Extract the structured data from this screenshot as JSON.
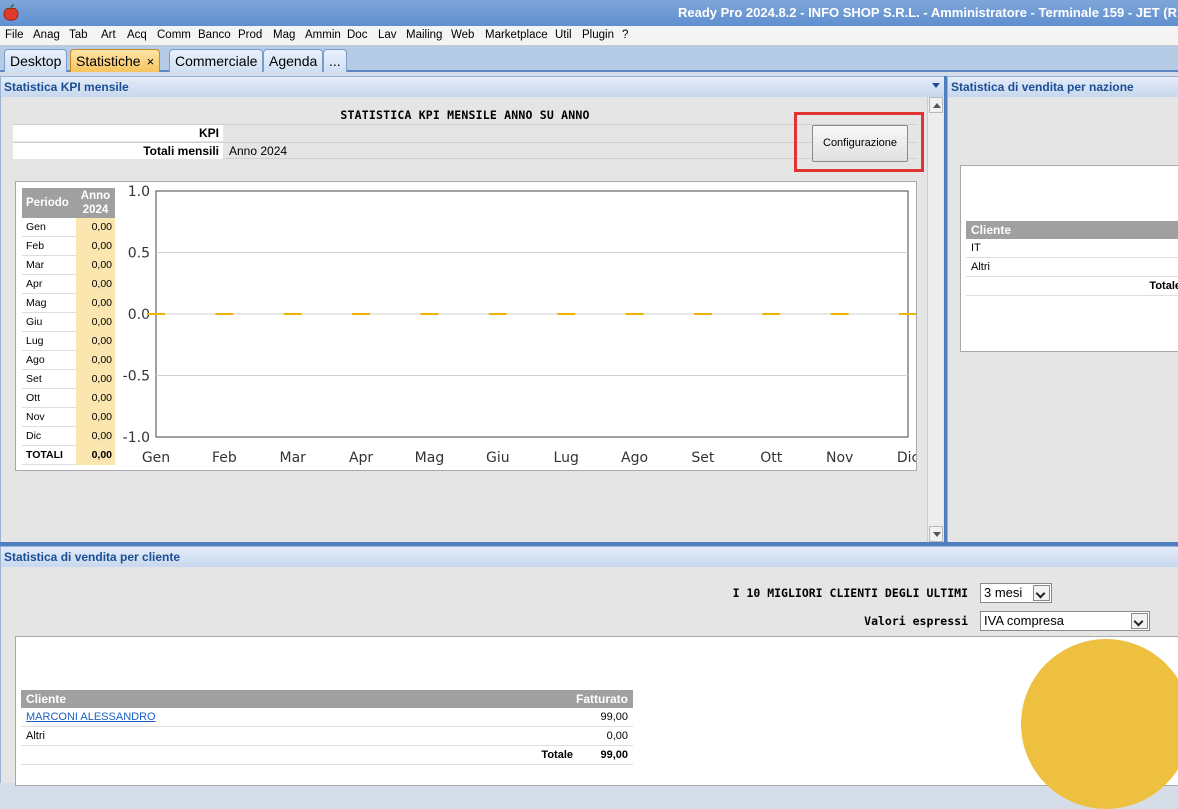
{
  "window": {
    "title": "Ready Pro 2024.8.2 - INFO SHOP S.R.L. - Amministratore - Terminale 159 - JET (R"
  },
  "menu": [
    "File",
    "Anag",
    "Tab",
    "Art",
    "Acq",
    "Comm",
    "Banco",
    "Prod",
    "Mag",
    "Ammin",
    "Doc",
    "Lav",
    "Mailing",
    "Web",
    "Marketplace",
    "Util",
    "Plugin",
    "?"
  ],
  "tabs": [
    {
      "label": "Desktop",
      "active": false
    },
    {
      "label": "Statistiche",
      "active": true,
      "close": "×"
    },
    {
      "label": "Commerciale",
      "active": false
    },
    {
      "label": "Agenda",
      "active": false
    },
    {
      "label": "...",
      "active": false
    }
  ],
  "kpi_panel": {
    "header": "Statistica KPI mensile",
    "title": "STATISTICA KPI MENSILE ANNO SU ANNO",
    "kpi_label": "KPI",
    "kpi_value": "",
    "totals_label": "Totali mensili",
    "totals_value": "Anno 2024",
    "config_button": "Configurazione",
    "table": {
      "col_period": "Periodo",
      "col_year": "Anno 2024",
      "rows": [
        {
          "month": "Gen",
          "value": "0,00"
        },
        {
          "month": "Feb",
          "value": "0,00"
        },
        {
          "month": "Mar",
          "value": "0,00"
        },
        {
          "month": "Apr",
          "value": "0,00"
        },
        {
          "month": "Mag",
          "value": "0,00"
        },
        {
          "month": "Giu",
          "value": "0,00"
        },
        {
          "month": "Lug",
          "value": "0,00"
        },
        {
          "month": "Ago",
          "value": "0,00"
        },
        {
          "month": "Set",
          "value": "0,00"
        },
        {
          "month": "Ott",
          "value": "0,00"
        },
        {
          "month": "Nov",
          "value": "0,00"
        },
        {
          "month": "Dic",
          "value": "0,00"
        }
      ],
      "total_label": "TOTALI",
      "total_value": "0,00"
    }
  },
  "chart_data": {
    "type": "bar",
    "categories": [
      "Gen",
      "Feb",
      "Mar",
      "Apr",
      "Mag",
      "Giu",
      "Lug",
      "Ago",
      "Set",
      "Ott",
      "Nov",
      "Dic"
    ],
    "values": [
      0,
      0,
      0,
      0,
      0,
      0,
      0,
      0,
      0,
      0,
      0,
      0
    ],
    "yticks": [
      "1.0",
      "0.5",
      "0.0",
      "-0.5",
      "-1.0"
    ],
    "ylim": [
      -1,
      1
    ],
    "grid": true,
    "bar_color": "#f0b400"
  },
  "nation_panel": {
    "header": "Statistica di vendita per nazione",
    "col_client": "Cliente",
    "rows": [
      "IT",
      "Altri"
    ],
    "total_label": "Totale"
  },
  "client_panel": {
    "header": "Statistica di vendita per cliente",
    "top_label": "I 10 MIGLIORI CLIENTI DEGLI ULTIMI",
    "period_value": "3 mesi",
    "values_label": "Valori espressi",
    "values_value": "IVA compresa",
    "col_client": "Cliente",
    "col_revenue": "Fatturato",
    "rows": [
      {
        "name": "MARCONI ALESSANDRO",
        "value": "99,00"
      },
      {
        "name": "Altri",
        "value": "0,00"
      }
    ],
    "total_label": "Totale",
    "total_value": "99,00"
  }
}
